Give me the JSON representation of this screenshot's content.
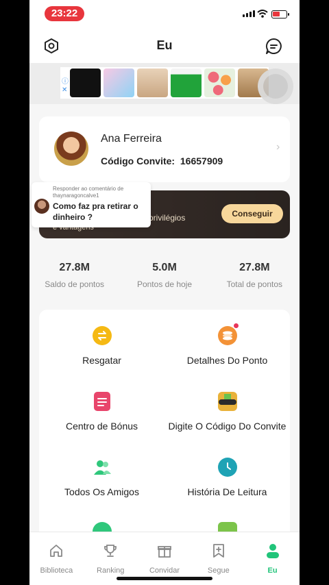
{
  "status": {
    "time": "23:22"
  },
  "header": {
    "title": "Eu"
  },
  "profile": {
    "name": "Ana Ferreira",
    "code_label": "Código Convite:",
    "code_value": "16657909"
  },
  "vip": {
    "text1": "privilégios",
    "text2": "e vantagens",
    "button": "Conseguir"
  },
  "popup": {
    "meta": "Responder ao comentário de thaynaragoncalve1",
    "message": "Como faz pra retirar o dinheiro ?"
  },
  "stats": [
    {
      "value": "27.8M",
      "label": "Saldo de pontos"
    },
    {
      "value": "5.0M",
      "label": "Pontos de hoje"
    },
    {
      "value": "27.8M",
      "label": "Total de pontos"
    }
  ],
  "grid": [
    {
      "label": "Resgatar",
      "icon": "exchange-icon",
      "color": "#f5b914"
    },
    {
      "label": "Detalhes Do Ponto",
      "icon": "coins-icon",
      "color": "#f39237"
    },
    {
      "label": "Centro de Bónus",
      "icon": "checklist-icon",
      "color": "#e8456b"
    },
    {
      "label": "Digite O Código Do Convite",
      "icon": "gift-30000-icon",
      "color": "#e9b23a"
    },
    {
      "label": "Todos Os Amigos",
      "icon": "friends-icon",
      "color": "#2fc77b"
    },
    {
      "label": "História De Leitura",
      "icon": "clock-icon",
      "color": "#1fa3b5"
    }
  ],
  "nav": [
    {
      "label": "Biblioteca",
      "icon": "home-icon"
    },
    {
      "label": "Ranking",
      "icon": "trophy-icon"
    },
    {
      "label": "Convidar",
      "icon": "gift-icon"
    },
    {
      "label": "Segue",
      "icon": "bookmark-plus-icon"
    },
    {
      "label": "Eu",
      "icon": "user-icon",
      "active": true
    }
  ],
  "colors": {
    "accent": "#21c47a",
    "status_red": "#e8363d"
  }
}
